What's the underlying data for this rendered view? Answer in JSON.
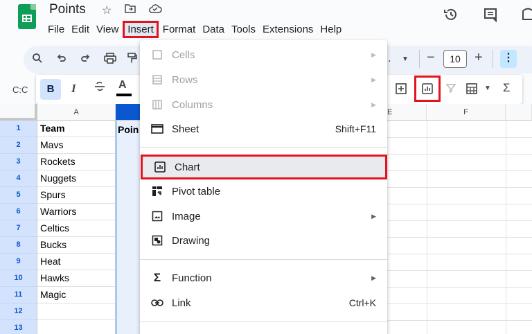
{
  "doc": {
    "title": "Points"
  },
  "menubar": [
    "File",
    "Edit",
    "View",
    "Insert",
    "Format",
    "Data",
    "Tools",
    "Extensions",
    "Help"
  ],
  "toolbar": {
    "font_size": "10",
    "name_box": "C:C",
    "bold": "B",
    "italic": "I",
    "strike": "S̶",
    "underline_a": "A",
    "sum": "Σ"
  },
  "grid": {
    "columns": [
      "A",
      "F"
    ],
    "col_e_fragment": "E",
    "col_b_header_text": "Poin",
    "rows": [
      "1",
      "2",
      "3",
      "4",
      "5",
      "6",
      "7",
      "8",
      "9",
      "10",
      "11",
      "12",
      "13"
    ],
    "col_a": [
      "Team",
      "Mavs",
      "Rockets",
      "Nuggets",
      "Spurs",
      "Warriors",
      "Celtics",
      "Bucks",
      "Heat",
      "Hawks",
      "Magic",
      "",
      ""
    ]
  },
  "insert_menu": {
    "items": [
      {
        "label": "Cells",
        "icon": "cells-icon",
        "submenu": true,
        "disabled": true
      },
      {
        "label": "Rows",
        "icon": "rows-icon",
        "submenu": true,
        "disabled": true
      },
      {
        "label": "Columns",
        "icon": "columns-icon",
        "submenu": true,
        "disabled": true
      },
      {
        "label": "Sheet",
        "icon": "sheet-icon",
        "shortcut": "Shift+F11"
      },
      {
        "label": "Chart",
        "icon": "chart-icon",
        "highlighted": true
      },
      {
        "label": "Pivot table",
        "icon": "pivot-table-icon"
      },
      {
        "label": "Image",
        "icon": "image-icon",
        "submenu": true
      },
      {
        "label": "Drawing",
        "icon": "drawing-icon"
      },
      {
        "label": "Function",
        "icon": "sigma-icon",
        "submenu": true
      },
      {
        "label": "Link",
        "icon": "link-icon",
        "shortcut": "Ctrl+K"
      }
    ]
  },
  "colors": {
    "highlight_border": "#e0141e",
    "selection": "#0b57d0",
    "sheets_green": "#0f9d58"
  }
}
